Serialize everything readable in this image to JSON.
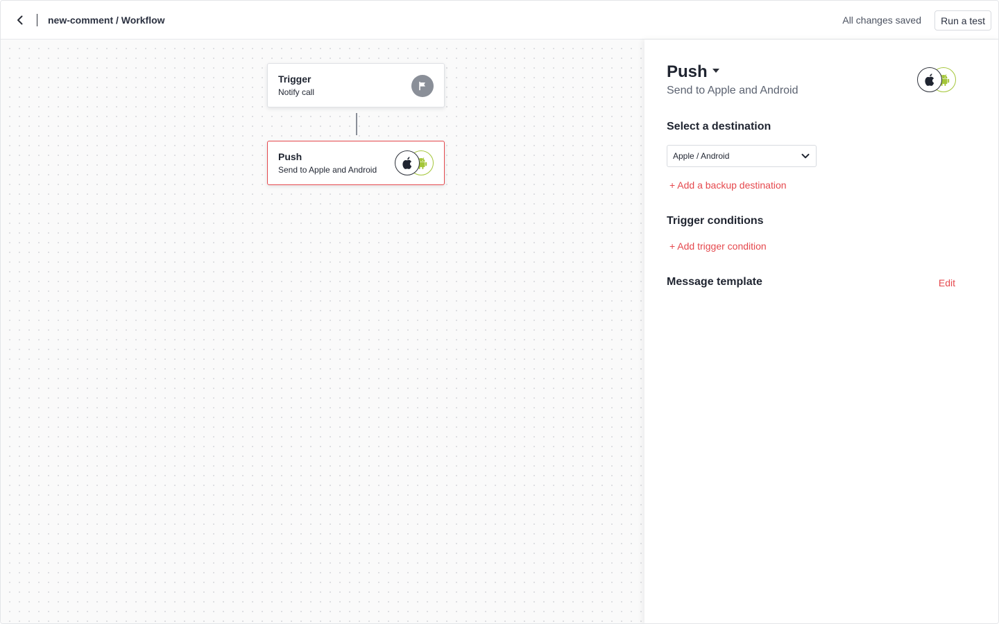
{
  "header": {
    "breadcrumb": "new-comment / Workflow",
    "save_status": "All changes saved",
    "run_test_label": "Run a test"
  },
  "canvas": {
    "nodes": [
      {
        "title": "Trigger",
        "subtitle": "Notify call",
        "icon": "flag-icon"
      },
      {
        "title": "Push",
        "subtitle": "Send to Apple and Android",
        "icon": "apple-android-icons",
        "selected": true
      }
    ]
  },
  "panel": {
    "title": "Push",
    "subtitle": "Send to Apple and Android",
    "destination_heading": "Select a destination",
    "destination_value": "Apple / Android",
    "add_backup_label": "+ Add a backup destination",
    "trigger_conditions_heading": "Trigger conditions",
    "add_condition_label": "+ Add trigger condition",
    "message_template_heading": "Message template",
    "edit_label": "Edit"
  },
  "colors": {
    "accent": "#e5484d",
    "android_green": "#a4c639",
    "text_primary": "#1f2430",
    "text_secondary": "#5b6270"
  }
}
